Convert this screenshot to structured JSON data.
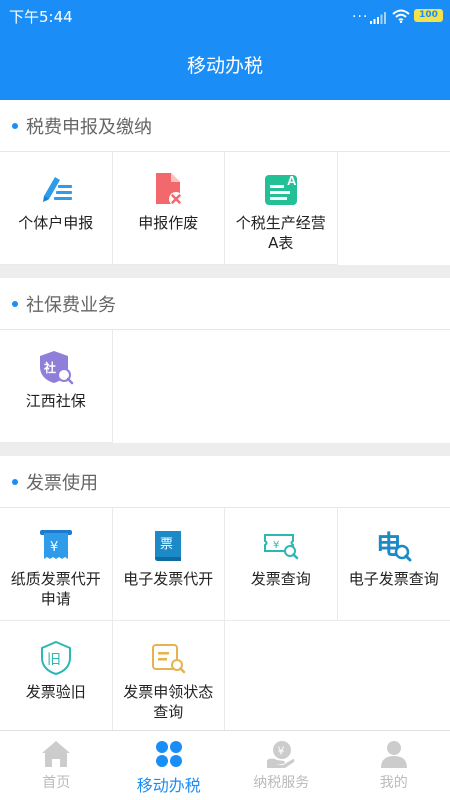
{
  "status_bar": {
    "time": "下午5:44",
    "dots": "...",
    "battery": "100"
  },
  "header": {
    "title": "移动办税"
  },
  "sections": [
    {
      "title": "税费申报及缴纳",
      "items": [
        {
          "label": "个体户申报",
          "icon": "pen-form-icon"
        },
        {
          "label": "申报作废",
          "icon": "document-cancel-icon"
        },
        {
          "label": "个税生产经营A表",
          "icon": "form-a-icon"
        }
      ]
    },
    {
      "title": "社保费业务",
      "items": [
        {
          "label": "江西社保",
          "icon": "social-security-shield-icon"
        }
      ]
    },
    {
      "title": "发票使用",
      "items": [
        {
          "label": "纸质发票代开申请",
          "icon": "paper-invoice-icon"
        },
        {
          "label": "电子发票代开",
          "icon": "e-invoice-issue-icon"
        },
        {
          "label": "发票查询",
          "icon": "invoice-search-icon"
        },
        {
          "label": "电子发票查询",
          "icon": "e-invoice-search-icon"
        },
        {
          "label": "发票验旧",
          "icon": "invoice-verify-icon"
        },
        {
          "label": "发票申领状态查询",
          "icon": "invoice-status-search-icon"
        }
      ]
    }
  ],
  "tabs": [
    {
      "label": "首页",
      "icon": "home-icon",
      "active": false
    },
    {
      "label": "移动办税",
      "icon": "grid-dots-icon",
      "active": true
    },
    {
      "label": "纳税服务",
      "icon": "tax-service-icon",
      "active": false
    },
    {
      "label": "我的",
      "icon": "user-icon",
      "active": false
    }
  ],
  "colors": {
    "primary": "#1a8ef6",
    "tab_inactive": "#bbbbbb",
    "icon_blue": "#2f9be9",
    "icon_red": "#f3686d",
    "icon_green": "#23bf96",
    "icon_purple": "#8f7fd9",
    "icon_teal": "#2cb7b3",
    "icon_orange": "#e6b24e"
  }
}
